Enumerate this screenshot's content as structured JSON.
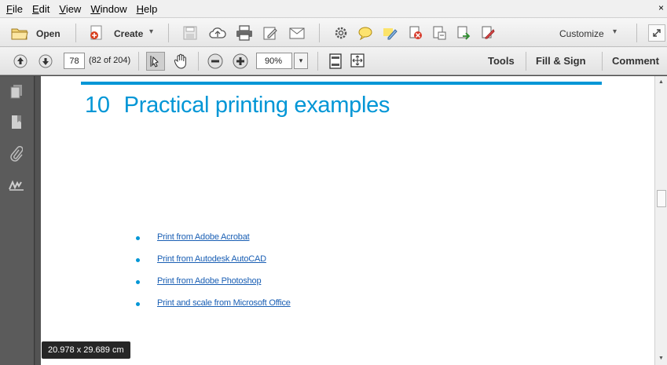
{
  "menu": {
    "items": [
      {
        "key": "F",
        "rest": "ile"
      },
      {
        "key": "E",
        "rest": "dit"
      },
      {
        "key": "V",
        "rest": "iew"
      },
      {
        "key": "W",
        "rest": "indow"
      },
      {
        "key": "H",
        "rest": "elp"
      }
    ],
    "close_glyph": "×"
  },
  "toolbar": {
    "open_label": "Open",
    "create_label": "Create",
    "customize_label": "Customize",
    "dropdown_glyph": "▾"
  },
  "nav": {
    "page_number": "78",
    "page_count_text": "(82 of 204)",
    "zoom": "90%",
    "tools_label": "Tools",
    "fill_sign_label": "Fill & Sign",
    "comment_label": "Comment"
  },
  "document": {
    "chapter_number": "10",
    "chapter_title": "Practical printing examples",
    "links": [
      "Print from Adobe Acrobat",
      "Print from Autodesk AutoCAD",
      "Print from Adobe Photoshop",
      "Print and scale from Microsoft Office"
    ]
  },
  "status": {
    "page_size": "20.978 x 29.689 cm"
  },
  "colors": {
    "accent": "#0096d6",
    "link": "#1a5fb4"
  }
}
